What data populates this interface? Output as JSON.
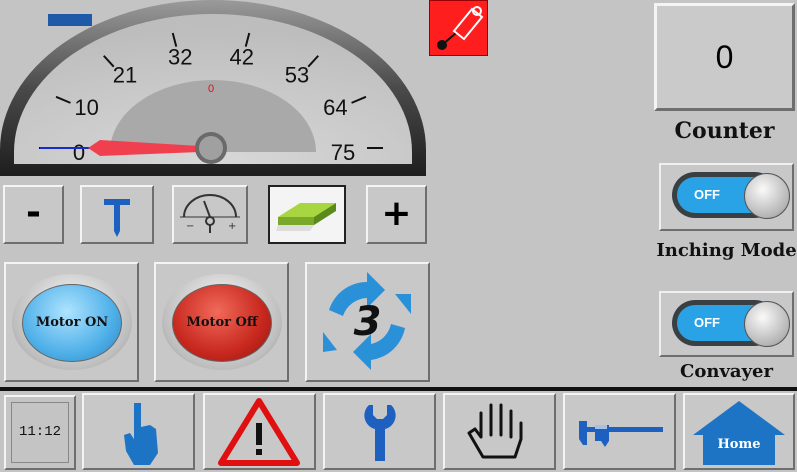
{
  "gauge": {
    "ticks": [
      "0",
      "10",
      "21",
      "32",
      "42",
      "53",
      "64",
      "75"
    ],
    "value_label": "0",
    "value": 0,
    "min": 0,
    "max": 75
  },
  "counter": {
    "value": "0",
    "label": "Counter"
  },
  "inching_mode": {
    "toggle_text": "OFF",
    "label": "Inching Mode",
    "state": "off"
  },
  "conveyor": {
    "toggle_text": "OFF",
    "label": "Convayer",
    "state": "off"
  },
  "controls": {
    "minus_label": "-",
    "plus_label": "+"
  },
  "motor": {
    "on_label": "Motor ON",
    "off_label": "Motor Off"
  },
  "cycle": {
    "count": "3"
  },
  "bottom_bar": {
    "time": "11:12",
    "home_label": "Home"
  },
  "colors": {
    "motor_on": "#4fb0e8",
    "motor_off": "#c8281e",
    "accent_blue": "#1e74c4",
    "warning_red": "#e01010",
    "alarm_red": "#ff2020"
  }
}
